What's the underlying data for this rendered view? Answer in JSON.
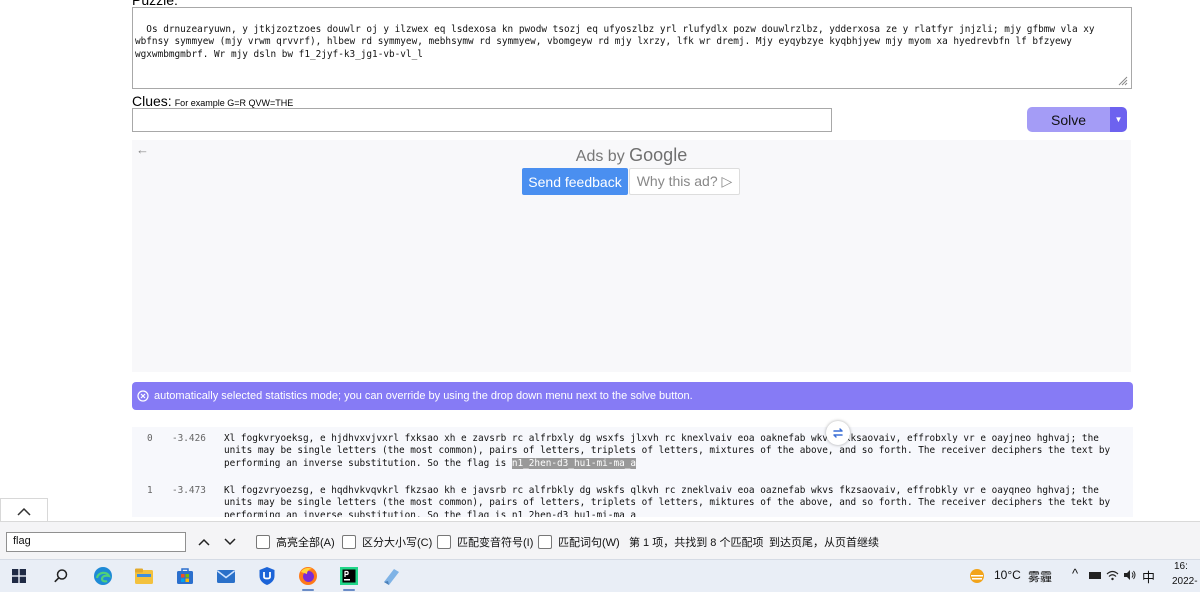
{
  "puzzle": {
    "label": "Puzzle:",
    "text": "Os drnuzearyuwn, y jtkjzoztzoes douwlr oj y ilzwex eq lsdexosa kn pwodw tsozj eq ufyoszlbz yrl rlufydlx pozw douwlrzlbz, ydderxosa ze y rlatfyr jnjzli; mjy gfbmw vla xy wbfnsy symmyew (mjy vrwm qrvvrf), hlbew rd symmyew, mebhsymw rd symmyew, vbomgeyw rd mjy lxrzy, lfk wr dremj. Mjy eyqybzye kyqbhjyew mjy myom xa hyedrevbfn lf bfzyewy wgxwmbmgmbrf. Wr mjy dsln bw f1_2jyf-k3_jg1-vb-vl_l"
  },
  "clues": {
    "label": "Clues:",
    "hint": "For example G=R QVW=THE",
    "value": ""
  },
  "solve": {
    "label": "Solve",
    "dropdown_glyph": "▼"
  },
  "ad": {
    "back_glyph": "←",
    "ads_by": "Ads by",
    "google": "Google",
    "send_feedback": "Send feedback",
    "why_this_ad": "Why this ad? ▷"
  },
  "alert": {
    "text": "automatically selected statistics mode; you can override by using the drop down menu next to the solve button."
  },
  "results": [
    {
      "index": "0",
      "score": "-3.426",
      "text": "Xl fogkvryoeksg, e hjdhvxvjvxrl fxksao xh e zavsrb rc alfrbxly dg wsxfs jlxvh rc knexlvaiv eoa oaknefab wkvs fxksaovaiv, effrobxly vr e oayjneo hghvaj; the units may be single letters (the most common), pairs of letters, triplets of letters, mixtures of the above, and so forth. The receiver deciphers the text by performing an inverse substitution. So the flag is ",
      "flag": "n1_2hen-d3_hu1-mi-ma_a"
    },
    {
      "index": "1",
      "score": "-3.473",
      "text": "Kl fogzvryoezsg, e hqdhvkvqvkrl fkzsao kh e javsrb rc alfrbkly dg wskfs qlkvh rc zneklvaiv eoa oaznefab wkvs fkzsaovaiv, effrobkly vr e oayqneo hghvaj; the units may be single letters (the most common), pairs of letters, triplets of letters, miktures of the above, and so forth. The receiver deciphers the tekt by performing an inverse substitution. So the flag is ",
      "flag": "n1_2hen-d3_hu1-mi-ma_a"
    }
  ],
  "find_bar": {
    "query": "flag",
    "highlight_all": "高亮全部(A)",
    "match_case": "区分大小写(C)",
    "match_diacritics": "匹配变音符号(I)",
    "whole_words": "匹配词句(W)",
    "status": "第 1 项，共找到 8 个匹配项",
    "wrapped": "到达页尾，从页首继续"
  },
  "taskbar": {
    "weather_temp": "10°C",
    "weather_desc": "雾霾",
    "ime": "中",
    "time": "16:",
    "date": "2022-"
  }
}
